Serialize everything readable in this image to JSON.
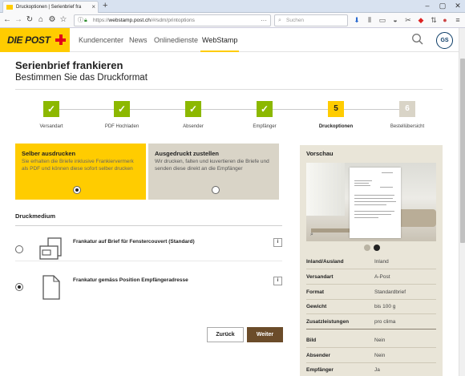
{
  "browser": {
    "tab_title": "Druckoptionen | Serienbrief fra",
    "url_prefix": "https://",
    "url_domain": "webstamp.post.ch",
    "url_path": "/#/sdm/printoptions",
    "search_placeholder": "Suchen"
  },
  "header": {
    "logo": "DIE POST",
    "nav": [
      "Kundencenter",
      "News",
      "Onlinedienste",
      "WebStamp"
    ],
    "active_nav": "WebStamp",
    "avatar_initials": "GS"
  },
  "page": {
    "title": "Serienbrief frankieren",
    "subtitle": "Bestimmen Sie das Druckformat"
  },
  "stepper": {
    "steps": [
      {
        "label": "Versandart",
        "state": "done"
      },
      {
        "label": "PDF Hochladen",
        "state": "done"
      },
      {
        "label": "Absender",
        "state": "done"
      },
      {
        "label": "Empfänger",
        "state": "done"
      },
      {
        "label": "Druckoptionen",
        "state": "current",
        "number": "5"
      },
      {
        "label": "Bestellübersicht",
        "state": "upcoming",
        "number": "6"
      }
    ],
    "check_glyph": "✓"
  },
  "options": {
    "self_print": {
      "title": "Selber ausdrucken",
      "desc": "Sie erhalten die Briefe inklusive Frankiervermerk als PDF und können diese sofort selber drucken",
      "selected": true
    },
    "delivered": {
      "title": "Ausgedruckt zustellen",
      "desc": "Wir drucken, falten und kuvertieren die Briefe und senden diese direkt an die Empfänger",
      "selected": false
    }
  },
  "druckmedium": {
    "title": "Druckmedium",
    "items": [
      {
        "label": "Frankatur auf Brief für Fenstercouvert (Standard)",
        "selected": false,
        "icon": "window-envelope-icon"
      },
      {
        "label": "Frankatur gemäss Position Empfängeradresse",
        "selected": true,
        "icon": "document-icon"
      }
    ],
    "info_glyph": "i"
  },
  "buttons": {
    "back": "Zurück",
    "next": "Weiter"
  },
  "preview": {
    "title": "Vorschau",
    "carousel_active_index": 1,
    "details": [
      {
        "key": "Inland/Ausland",
        "value": "Inland"
      },
      {
        "key": "Versandart",
        "value": "A-Post"
      },
      {
        "key": "Format",
        "value": "Standardbrief"
      },
      {
        "key": "Gewicht",
        "value": "bis 100 g"
      },
      {
        "key": "Zusatzleistungen",
        "value": "pro clima"
      },
      {
        "key": "Bild",
        "value": "Nein"
      },
      {
        "key": "Absender",
        "value": "Nein"
      },
      {
        "key": "Empfänger",
        "value": "Ja"
      }
    ]
  },
  "colors": {
    "brand_yellow": "#ffcc00",
    "post_red": "#e2001a",
    "step_done": "#8cb800",
    "button_dark": "#6b4c2a",
    "panel_beige": "#e9e5d8"
  }
}
